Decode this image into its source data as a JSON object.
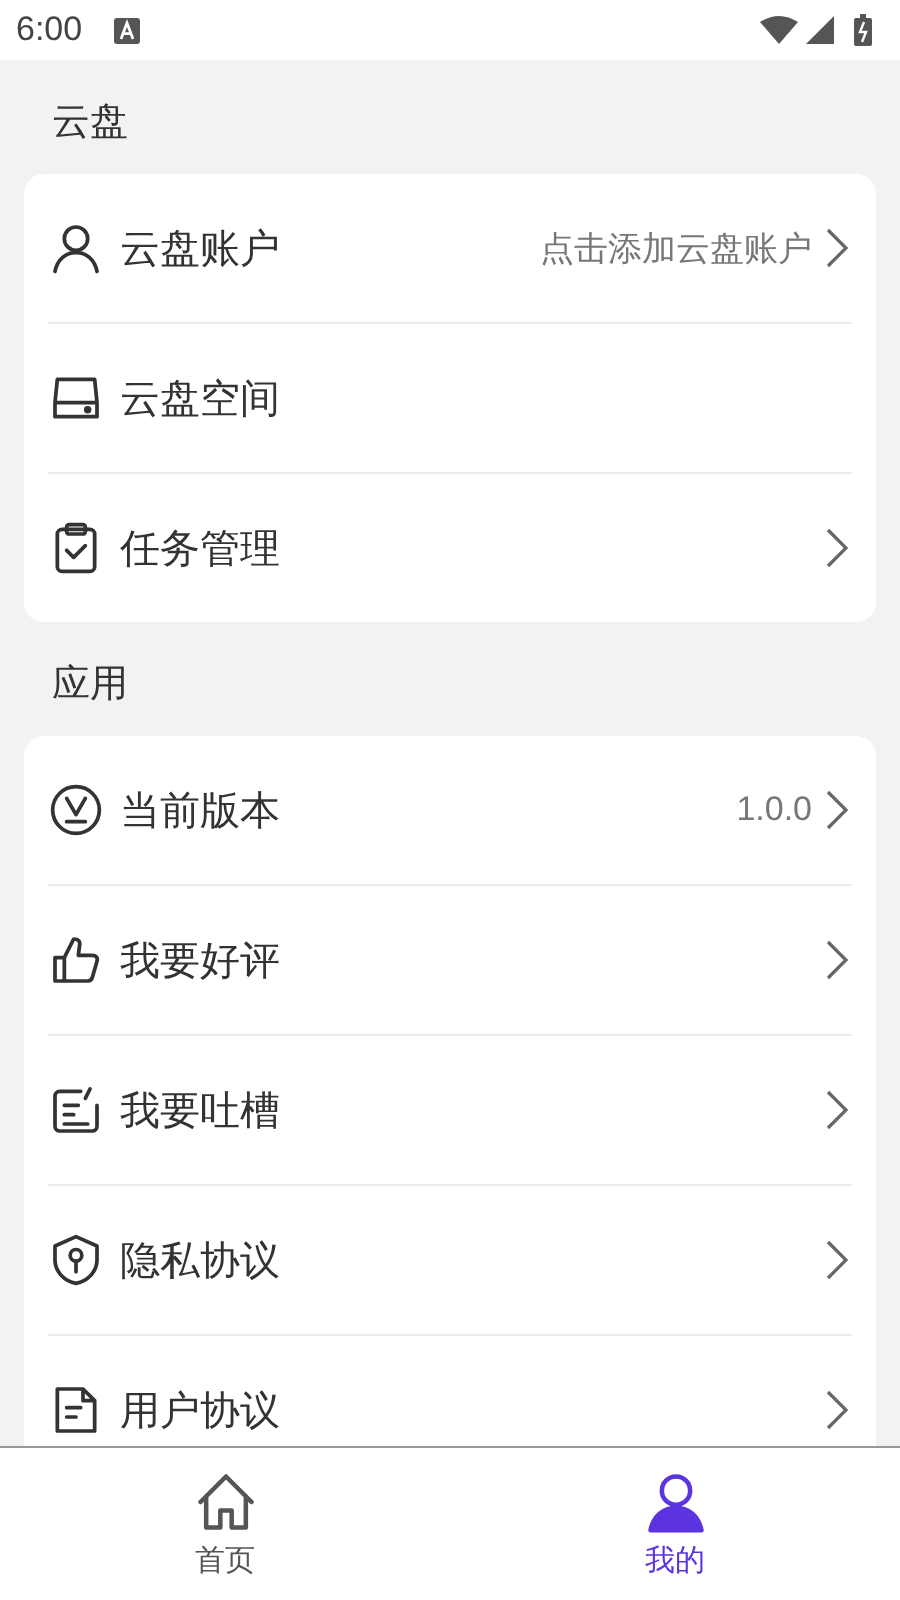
{
  "status_bar": {
    "time": "6:00"
  },
  "sections": [
    {
      "title": "云盘",
      "items": [
        {
          "label": "云盘账户",
          "value": "点击添加云盘账户",
          "chevron": true
        },
        {
          "label": "云盘空间",
          "chevron": false
        },
        {
          "label": "任务管理",
          "chevron": true
        }
      ]
    },
    {
      "title": "应用",
      "items": [
        {
          "label": "当前版本",
          "value": "1.0.0",
          "chevron": true
        },
        {
          "label": "我要好评",
          "chevron": true
        },
        {
          "label": "我要吐槽",
          "chevron": true
        },
        {
          "label": "隐私协议",
          "chevron": true
        },
        {
          "label": "用户协议",
          "chevron": true
        }
      ]
    }
  ],
  "tab_bar": [
    {
      "label": "首页",
      "selected": false
    },
    {
      "label": "我的",
      "selected": true
    }
  ]
}
